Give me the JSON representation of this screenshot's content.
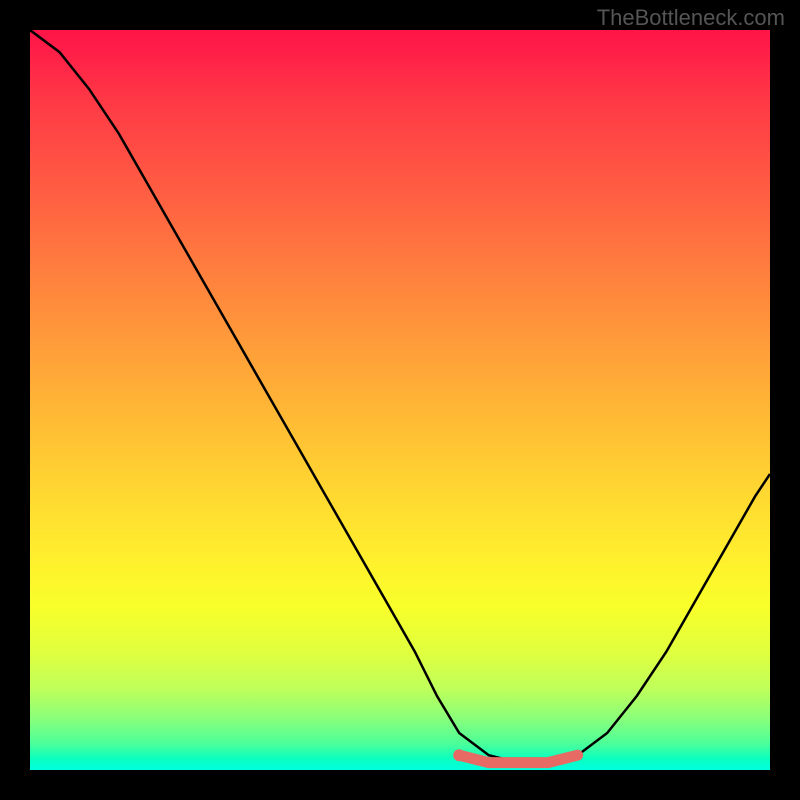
{
  "watermark": "TheBottleneck.com",
  "chart_data": {
    "type": "line",
    "title": "",
    "xlabel": "",
    "ylabel": "",
    "xlim": [
      0,
      100
    ],
    "ylim": [
      0,
      100
    ],
    "series": [
      {
        "name": "bottleneck-curve",
        "x": [
          0,
          4,
          8,
          12,
          16,
          20,
          24,
          28,
          32,
          36,
          40,
          44,
          48,
          52,
          55,
          58,
          62,
          66,
          70,
          74,
          78,
          82,
          86,
          90,
          94,
          98,
          100
        ],
        "y": [
          100,
          97,
          92,
          86,
          79,
          72,
          65,
          58,
          51,
          44,
          37,
          30,
          23,
          16,
          10,
          5,
          2,
          1,
          1,
          2,
          5,
          10,
          16,
          23,
          30,
          37,
          40
        ]
      },
      {
        "name": "optimal-range-marker",
        "x": [
          58,
          62,
          66,
          70,
          74
        ],
        "y": [
          2,
          1,
          1,
          1,
          2
        ]
      }
    ],
    "colors": {
      "curve": "#000000",
      "marker": "#e86a65",
      "gradient_top": "#ff1448",
      "gradient_bottom": "#00ffe0"
    }
  }
}
